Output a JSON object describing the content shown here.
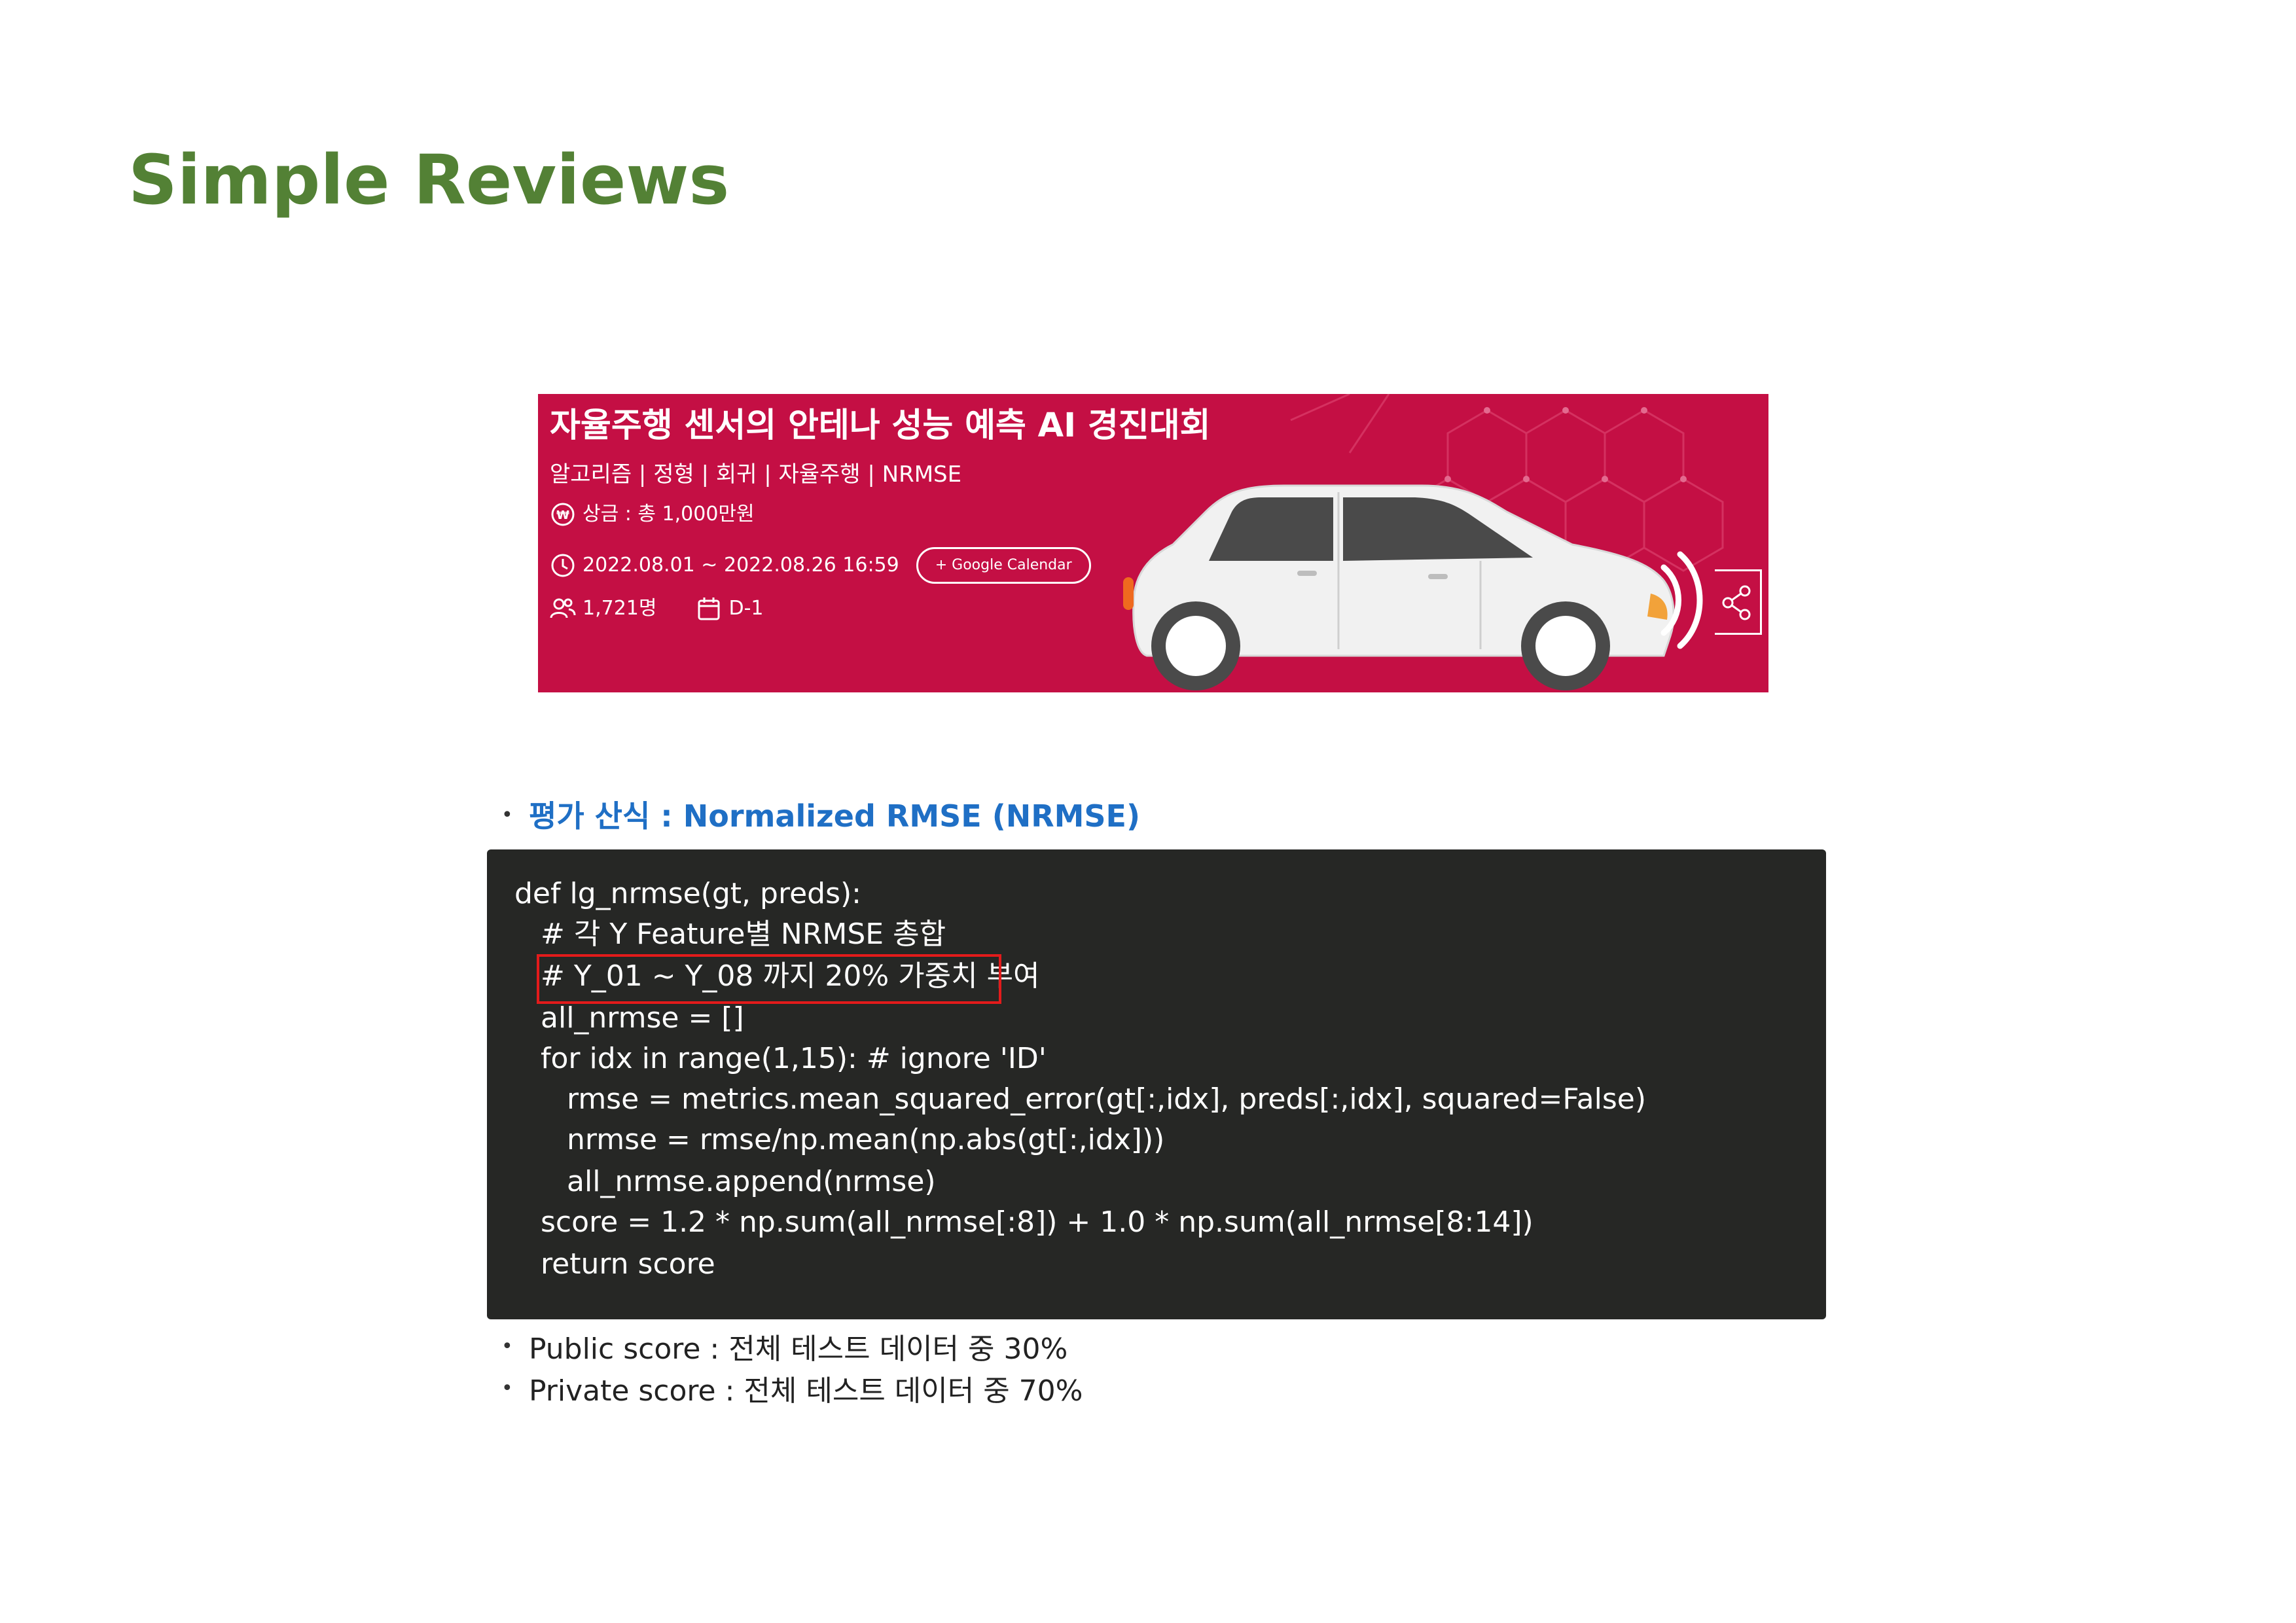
{
  "slide": {
    "title": "Simple Reviews"
  },
  "banner": {
    "title": "자율주행 센서의 안테나 성능 예측 AI 경진대회",
    "tags": "알고리즘 | 정형 | 회귀 | 자율주행 | NRMSE",
    "prize": "상금 : 총 1,000만원",
    "period": "2022.08.01 ~ 2022.08.26 16:59",
    "calendar_button": "+ Google Calendar",
    "participants": "1,721명",
    "dday": "D-1",
    "colors": {
      "background": "#c40f44"
    },
    "icons": [
      "won-icon",
      "clock-icon",
      "people-icon",
      "calendar-icon",
      "share-icon",
      "car-illustration"
    ]
  },
  "evaluation": {
    "heading": "평가 산식 : Normalized RMSE (NRMSE)",
    "code_lines": [
      "def lg_nrmse(gt, preds):",
      "# 각 Y Feature별 NRMSE 총합",
      "# Y_01 ~ Y_08 까지 20% 가중치 부여",
      "all_nrmse = []",
      "for idx in range(1,15): # ignore 'ID'",
      "rmse = metrics.mean_squared_error(gt[:,idx], preds[:,idx], squared=False)",
      "nrmse = rmse/np.mean(np.abs(gt[:,idx]))",
      "all_nrmse.append(nrmse)",
      "score = 1.2 * np.sum(all_nrmse[:8]) + 1.0 * np.sum(all_nrmse[8:14])",
      "return score"
    ],
    "public_score": "Public score : 전체 테스트 데이터 중 30%",
    "private_score": "Private score : 전체 테스트 데이터 중 70%",
    "colors": {
      "heading": "#1f6fc5",
      "code_bg": "#262725",
      "highlight": "#e31b1b",
      "title": "#538135"
    }
  }
}
